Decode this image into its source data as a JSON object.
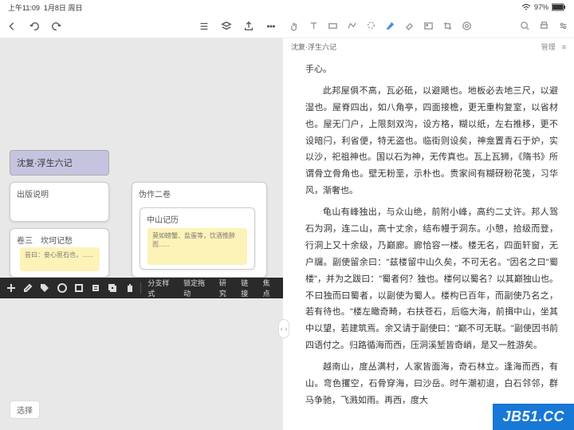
{
  "status": {
    "time": "上午11:09",
    "date": "1月8日 周日",
    "battery": "97%"
  },
  "leftToolbar": {
    "back_icon": "chevron-left"
  },
  "titleCard": "沈复·浮生六记",
  "cards": {
    "pub": "出版说明",
    "wei": "伪作二卷",
    "j3": "卷三　坎坷记愁",
    "zs": "中山记历"
  },
  "stickies": {
    "s1": "芸曰：妾心匪石也，......",
    "s2": "莫如螃蟹、盐蛋等，饮酒惟醉而......"
  },
  "blackToolbar": {
    "labels": [
      "分支样式",
      "锁定拖动",
      "研究",
      "链接",
      "焦点"
    ]
  },
  "selectBtn": "选择",
  "rightDoc": {
    "title": "沈复·浮生六记",
    "menu": "管理",
    "p0": "手心。",
    "p1": "此邦屋俱不高，瓦必砥，以避飓也。地板必去地三尺，以避湿也。屋脊四出，如八角亭，四面接檐，更无重构复室，以省材也。屋无门户，上限刻双沟，设方格，糊以纸，左右推移，更不设暗闩，利省便，特无盗也。临街则设矣，神龛置青石于炉，实以沙，祀祖神也。国以石为神，无传真也。瓦上瓦狮，《隋书》所谓骨立骨角也。壁无粉垩，示朴也。贵家间有糊砑粉花笺，习华风，渐奢也。",
    "p2": "龟山有峰独出，与众山绝，前附小峰，高约二丈许。邦人驾石为洞，连二山，高十丈余，结布幔于洞东。小憩，拾级而登，行洞上又十余级，乃巅廊。廊恰容一楼。楼无名，四面轩窗，无户牖。副使留余曰：\"兹楼留中山久矣，不可无名。\"因名之曰\"蜀楼\"，并为之跋曰：\"蜀者何？独也。楼何以蜀名？以其巅独山也。不曰独而曰蜀者，以副使为蜀人。楼构已百年，而副使乃名之，若有待也。\"楼左瞰奇畸，右扶苍石，后临大海，前揖中山，坐其中以望，若建筑焉。余又请于副使曰：\"巅不可无联。\"副使因书前四语付之。归路循海而西，压洞溪堑皆奇峭，是又一胜游矣。",
    "p3": "越南山，度丛满村，人家皆面海，奇石林立。逢海而西，有山。弯色攫空，石骨穿海，曰沙岳。时午潮初退，白石邻邻，群马争驰，飞溅如雨。再西，度大"
  },
  "watermark": "JB51.CC"
}
